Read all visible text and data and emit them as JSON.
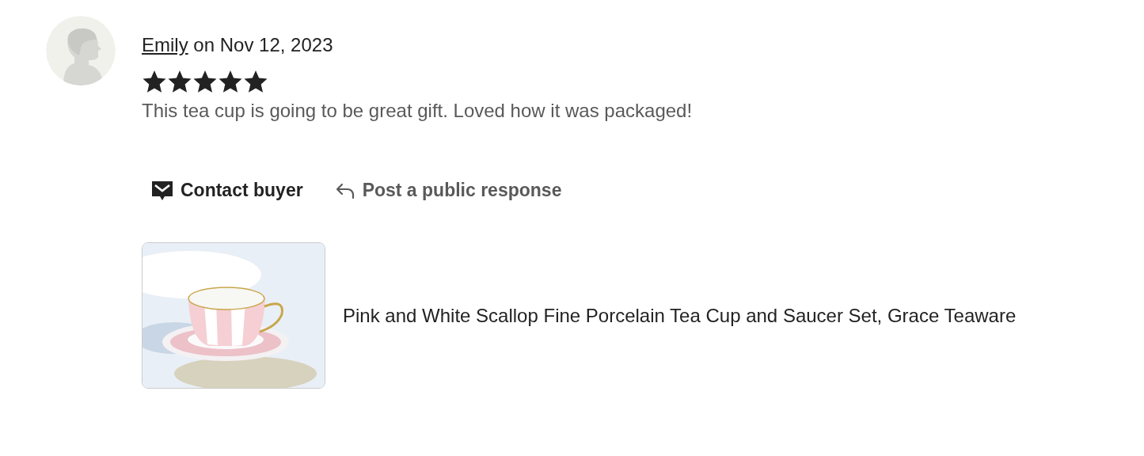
{
  "review": {
    "reviewer": "Emily",
    "date_text": "on Nov 12, 2023",
    "stars": 5,
    "text": "This tea cup is going to be great gift. Loved how it was packaged!"
  },
  "actions": [
    {
      "kind": "contact",
      "label": "Contact buyer"
    },
    {
      "kind": "respond",
      "label": "Post a public response"
    }
  ],
  "product": {
    "title": "Pink and White Scallop Fine Porcelain Tea Cup and Saucer Set, Grace Teaware"
  }
}
